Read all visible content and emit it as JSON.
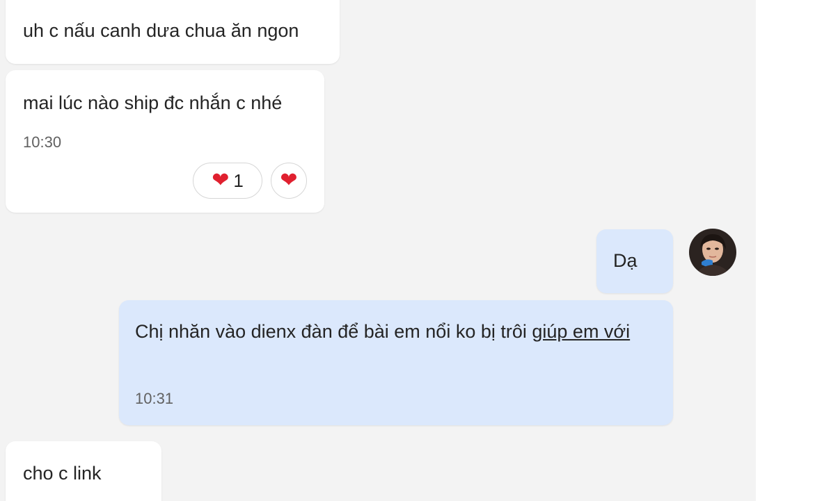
{
  "messages": [
    {
      "direction": "incoming",
      "text": "uh c nấu canh dưa chua ăn ngon"
    },
    {
      "direction": "incoming",
      "text": "mai lúc nào ship đc nhắn c nhé",
      "time": "10:30",
      "reactions": {
        "emoji": "heart",
        "count": "1"
      }
    },
    {
      "direction": "outgoing",
      "text": "Dạ"
    },
    {
      "direction": "outgoing",
      "text_plain": "Chị nhăn vào dienx đàn để bài em nổi ko bị trôi ",
      "text_link": "giúp em với",
      "time": "10:31"
    },
    {
      "direction": "incoming",
      "text": "cho c link"
    }
  ],
  "colors": {
    "chat_background": "#f3f3f3",
    "incoming_bubble": "#ffffff",
    "outgoing_bubble": "#dbe8fc",
    "heart": "#e0202f"
  }
}
